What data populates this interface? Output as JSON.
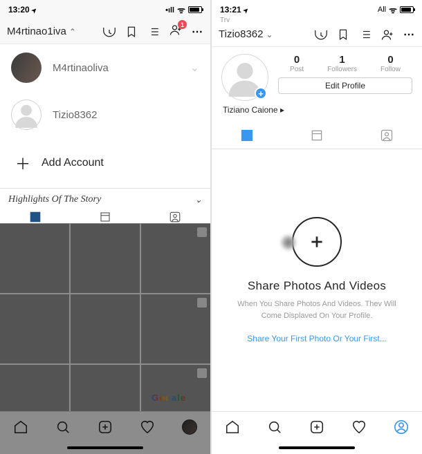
{
  "left": {
    "status": {
      "time": "13:20",
      "arrow": true
    },
    "header": {
      "username": "M4rtinao1iva",
      "badge_count": "1"
    },
    "dropdown": {
      "accounts": [
        {
          "name": "M4rtinaoliva",
          "has_photo": true
        },
        {
          "name": "Tizio8362",
          "has_photo": false
        }
      ],
      "add_label": "Add Account"
    },
    "highlights_label": "Highlights Of The Story"
  },
  "right": {
    "status": {
      "time": "13:21",
      "carrier": "All"
    },
    "sub_user": "Trv",
    "header": {
      "username": "Tizio8362"
    },
    "profile": {
      "stats": {
        "post_n": "0",
        "post_l": "Post",
        "followers_n": "1",
        "followers_l": "Followers",
        "follow_n": "0",
        "follow_l": "Follow"
      },
      "edit_label": "Edit Profile",
      "display_name": "Tiziano Caione"
    },
    "empty": {
      "title": "Share Photos And Videos",
      "desc": "When You Share Photos And Videos. Thev Will Come Displaved On Your Profile.",
      "cta": "Share Your First Photo Or Your First..."
    }
  }
}
